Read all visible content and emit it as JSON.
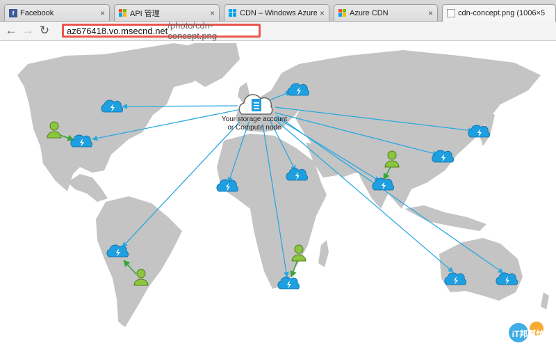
{
  "tabs": [
    {
      "title": "Facebook",
      "icon": "facebook-icon"
    },
    {
      "title": "API 管理",
      "icon": "windows-logo-icon"
    },
    {
      "title": "CDN – Windows Azure",
      "icon": "windows-logo-icon"
    },
    {
      "title": "Azure CDN",
      "icon": "windows-logo-icon"
    },
    {
      "title": "cdn-concept.png (1006×5",
      "icon": "document-icon"
    }
  ],
  "tab_close_glyph": "×",
  "toolbar": {
    "back_icon": "back-arrow-icon",
    "forward_icon": "forward-arrow-icon",
    "reload_icon": "reload-icon",
    "url_host": "az676418.vo.msecnd.net",
    "url_path": "/photo/cdn-concept.png",
    "url_highlight_color": "#e9574d"
  },
  "diagram": {
    "origin_label_line1": "Your storage account",
    "origin_label_line2": "or Compute node",
    "land_color": "#c4c4c4",
    "arrow_color": "#29a8e0",
    "user_arrow_color": "#3aa53a",
    "cloud_color": "#1e9fe0",
    "user_color": "#8cc63f",
    "watermark_text": "iT邦幫忙"
  }
}
